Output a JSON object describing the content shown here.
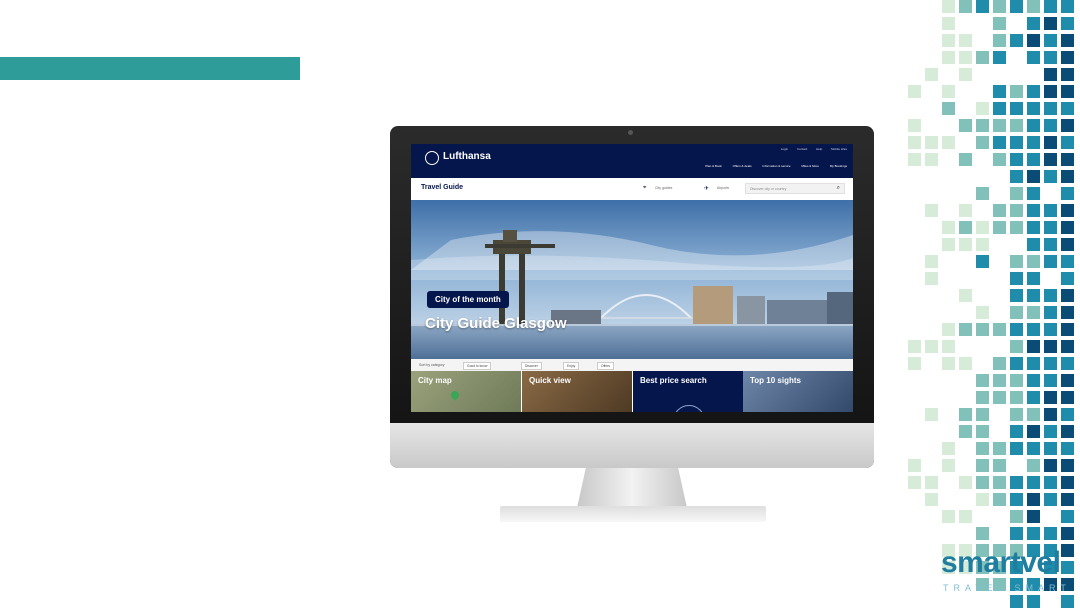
{
  "colors": {
    "accent_teal": "#2e9c98",
    "lufthansa_navy": "#05164d",
    "mosaic_dark": "#0b4c77",
    "mosaic_mid": "#1f8cab",
    "mosaic_teal": "#82c1ba",
    "mosaic_light": "#d7ebd9"
  },
  "site": {
    "logo_text": "Lufthansa",
    "top_links": [
      "Login",
      "Contact",
      "Help",
      "Mobile sites"
    ],
    "nav_items": [
      "Plan & Book",
      "Offers & deals",
      "Information & service",
      "Miles & More",
      "My Bookings"
    ],
    "section_title": "Travel Guide",
    "city_guides_label": "City guides",
    "airports_label": "Airports",
    "search_placeholder": "Discover city or country",
    "hero_badge": "City of the month",
    "hero_title": "City Guide Glasgow",
    "sort_label": "Sort by category",
    "sort_chips": [
      "Good to know",
      "Discover",
      "Enjoy",
      "Offers"
    ],
    "tiles": [
      "City map",
      "Quick view",
      "Best price search",
      "Top 10 sights"
    ]
  },
  "brand": {
    "name": "smartvel",
    "tagline": "TRAVEL SMART"
  },
  "icons": {
    "search": "search-icon",
    "city": "city-pin-icon",
    "airport": "plane-icon"
  }
}
